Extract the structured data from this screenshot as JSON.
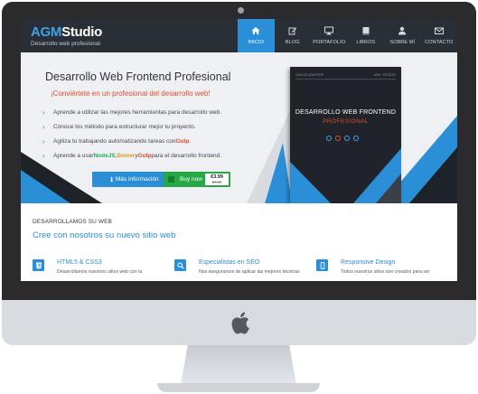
{
  "brand": {
    "logo_part1": "AGM",
    "logo_part2": "Studio",
    "tagline": "Desarrollo web profesional"
  },
  "nav": [
    {
      "label": "INICIO",
      "icon": "home-icon",
      "active": true
    },
    {
      "label": "BLOG",
      "icon": "edit-icon",
      "active": false
    },
    {
      "label": "PORTAFOLIO",
      "icon": "monitor-icon",
      "active": false
    },
    {
      "label": "LIBROS",
      "icon": "book-icon",
      "active": false
    },
    {
      "label": "SOBRE MÍ",
      "icon": "user-icon",
      "active": false
    },
    {
      "label": "CONTACTO",
      "icon": "envelope-icon",
      "active": false
    }
  ],
  "hero": {
    "title": "Desarrollo Web Frontend Profesional",
    "subtitle": "¡Conviértete en un profesional del desarrollo web!",
    "features": [
      {
        "text": "Aprende a utilizar las mejores herramientas para desarrollo web."
      },
      {
        "text": "Conoce los método para estructurar mejor tu proyecto."
      },
      {
        "pre": "Agiliza tu trabajando automatizando tareas con ",
        "hl1": "Gulp",
        "post": "."
      },
      {
        "pre": "Aprende a usar ",
        "hl1": "NodeJS",
        "sep1": ", ",
        "hl2": "Bower",
        "sep2": " y ",
        "hl3": "Gulp",
        "post": " para el desarrollo frontend."
      }
    ],
    "info_button": "Más información",
    "buy_button": "Buy now",
    "price_now": "€3.99",
    "price_old": "$4.99"
  },
  "book": {
    "top_left": "CARLOS AZAUSTRE",
    "top_right": "AGM · ESTUDIO",
    "title": "DESARROLLO WEB FRONTEND",
    "subtitle": "PROFESIONAL"
  },
  "section": {
    "label": "DESARROLLAMOS SU WEB",
    "title": "Cree con nosotros su nuevo sitio web"
  },
  "cards": [
    {
      "title": "HTML5 & CSS3",
      "text": "Desarrollamos nuestros sitios web con la",
      "icon": "html5-icon"
    },
    {
      "title": "Especialistas en SEO",
      "text": "Nos aseguramos de aplicar las mejores técnicas",
      "icon": "magnifier-icon"
    },
    {
      "title": "Responsive Design",
      "text": "Todos nuestros sitios son creados para ser",
      "icon": "mobile-icon"
    }
  ],
  "colors": {
    "accent": "#2a8fd6",
    "header_bg": "#2a2f37",
    "highlight_red": "#d9502e",
    "buy_green": "#27a844"
  }
}
